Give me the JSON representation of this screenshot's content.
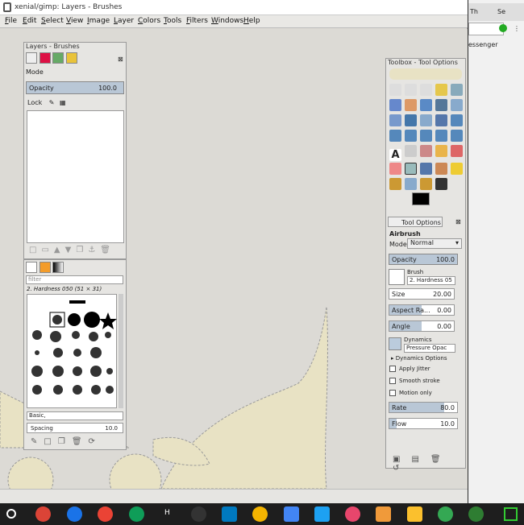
{
  "window": {
    "title": "xenial/gimp: Layers - Brushes"
  },
  "menu": [
    "File",
    "Edit",
    "Select",
    "View",
    "Image",
    "Layer",
    "Colors",
    "Tools",
    "Filters",
    "Windows",
    "Help"
  ],
  "layers_dock": {
    "title": "Layers - Brushes",
    "mode_label": "Mode",
    "opacity_label": "Opacity",
    "opacity_value": "100.0",
    "lock_label": "Lock"
  },
  "brushes_dock": {
    "filter_placeholder": "filter",
    "brush_name": "2. Hardness 050 (51 × 31)",
    "preset": "Basic,",
    "spacing_label": "Spacing",
    "spacing_value": "10.0"
  },
  "toolbox": {
    "title": "Toolbox - Tool Options",
    "options_tab": "Tool Options",
    "tool_name": "Airbrush",
    "mode_label": "Mode:",
    "mode_value": "Normal",
    "opacity_label": "Opacity",
    "opacity_value": "100.0",
    "brush_label": "Brush",
    "brush_value": "2. Hardness 05",
    "size_label": "Size",
    "size_value": "20.00",
    "aspect_label": "Aspect Ra...",
    "aspect_value": "0.00",
    "angle_label": "Angle",
    "angle_value": "0.00",
    "dynamics_label": "Dynamics",
    "dynamics_value": "Pressure Opac",
    "dynamics_options": "Dynamics Options",
    "apply_jitter": "Apply Jitter",
    "smooth_stroke": "Smooth stroke",
    "motion_only": "Motion only",
    "rate_label": "Rate",
    "rate_value": "80.0",
    "flow_label": "Flow",
    "flow_value": "10.0"
  },
  "browser": {
    "tab1": "Th",
    "tab2": "Se",
    "partial_text": "essenger"
  },
  "colors": {
    "canvas_shape": "#e8e2c4",
    "accent": "#b9c7d6"
  }
}
